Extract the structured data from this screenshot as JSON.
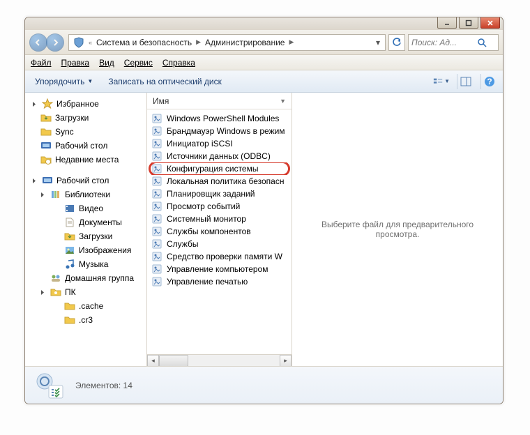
{
  "breadcrumb": {
    "seg1": "Система и безопасность",
    "seg2": "Администрирование"
  },
  "search": {
    "placeholder": "Поиск: Ад..."
  },
  "menubar": {
    "file": "Файл",
    "edit": "Правка",
    "view": "Вид",
    "tools": "Сервис",
    "help": "Справка"
  },
  "toolbar": {
    "organize": "Упорядочить",
    "burn": "Записать на оптический диск"
  },
  "sidebar": {
    "favorites": "Избранное",
    "fav": {
      "downloads": "Загрузки",
      "sync": "Sync",
      "desktop": "Рабочий стол",
      "recent": "Недавние места"
    },
    "desktop": "Рабочий стол",
    "libraries": "Библиотеки",
    "lib": {
      "videos": "Видео",
      "documents": "Документы",
      "downloads": "Загрузки",
      "pictures": "Изображения",
      "music": "Музыка"
    },
    "homegroup": "Домашняя группа",
    "pc": "ПК",
    "pcchild": {
      "cache": ".cache",
      "cr3": ".cr3"
    }
  },
  "columns": {
    "name": "Имя"
  },
  "files": {
    "items": [
      "Windows PowerShell Modules",
      "Брандмауэр Windows в режим",
      "Инициатор iSCSI",
      "Источники данных (ODBC)",
      "Конфигурация системы",
      "Локальная политика безопасн",
      "Планировщик заданий",
      "Просмотр событий",
      "Системный монитор",
      "Службы компонентов",
      "Службы",
      "Средство проверки памяти W",
      "Управление компьютером",
      "Управление печатью"
    ]
  },
  "preview": {
    "text": "Выберите файл для предварительного просмотра."
  },
  "status": {
    "count_label": "Элементов: 14"
  }
}
